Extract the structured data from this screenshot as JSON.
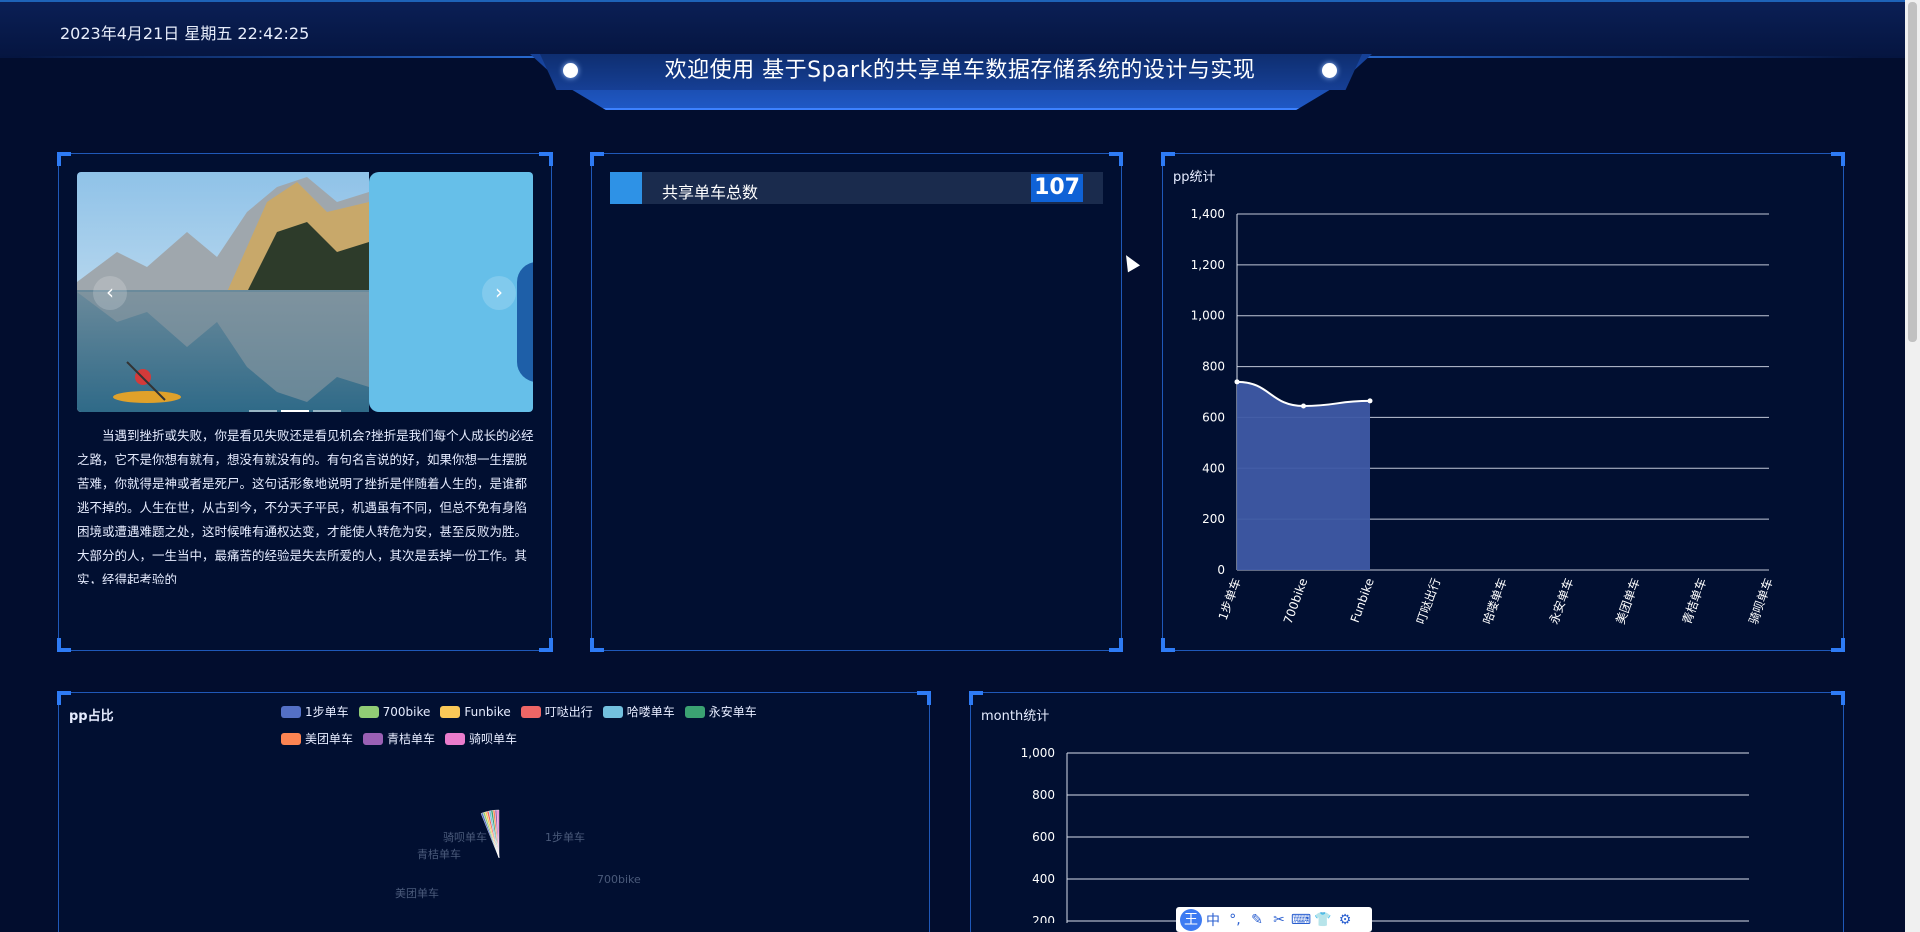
{
  "header": {
    "datetime": "2023年4月21日 星期五 22:42:25",
    "title": "欢迎使用 基于Spark的共享单车数据存储系统的设计与实现"
  },
  "carousel": {
    "prev_icon": "‹",
    "next_icon": "›",
    "paragraph": "当遇到挫折或失败，你是看见失败还是看见机会?挫折是我们每个人成长的必经之路，它不是你想有就有，想没有就没有的。有句名言说的好，如果你想一生摆脱苦难，你就得是神或者是死尸。这句话形象地说明了挫折是伴随着人生的，是谁都逃不掉的。人生在世，从古到今，不分天子平民，机遇虽有不同，但总不免有身陷困境或遭遇难题之处，这时候唯有通权达变，才能使人转危为安，甚至反败为胜。大部分的人，一生当中，最痛苦的经验是失去所爱的人，其次是丢掉一份工作。其实，经得起考验的"
  },
  "counter": {
    "label": "共享单车总数",
    "value": "107"
  },
  "pp_chart": {
    "title": "pp统计"
  },
  "pie_chart": {
    "title": "pp占比"
  },
  "month_chart": {
    "title": "month统计"
  },
  "colors": {
    "accent": "#2e7bf5",
    "area": "#3e5aa5",
    "background": "#020d2e"
  },
  "chart_data": [
    {
      "type": "area",
      "title": "pp统计",
      "categories": [
        "1步单车",
        "700bike",
        "Funbike",
        "叮哒出行",
        "哈喽单车",
        "永安单车",
        "美团单车",
        "青桔单车",
        "骑呗单车"
      ],
      "values": [
        740,
        645,
        665,
        null,
        null,
        null,
        null,
        null,
        null
      ],
      "ylim": [
        0,
        1400
      ],
      "yticks": [
        "0",
        "200",
        "400",
        "600",
        "800",
        "1,000",
        "1,200",
        "1,400"
      ],
      "grid": true
    },
    {
      "type": "pie",
      "title": "pp占比",
      "legend": [
        "1步单车",
        "700bike",
        "Funbike",
        "叮哒出行",
        "哈喽单车",
        "永安单车",
        "美团单车",
        "青桔单车",
        "骑呗单车"
      ],
      "colors": [
        "#5470c6",
        "#91cc75",
        "#fac858",
        "#ee6666",
        "#73c0de",
        "#3ba272",
        "#fc8452",
        "#9a60b4",
        "#ea7ccc"
      ],
      "slice_labels": [
        "1步单车",
        "700bike",
        "美团单车",
        "青桔单车",
        "骑呗单车"
      ],
      "legend_position": "top"
    },
    {
      "type": "bar",
      "title": "month统计",
      "ylim": [
        0,
        1000
      ],
      "yticks": [
        "200",
        "400",
        "600",
        "800",
        "1,000"
      ],
      "grid": true
    }
  ],
  "ime_toolbar": {
    "logo": "王",
    "lang": "中",
    "items": [
      "°,",
      "✎",
      "✂",
      "⌨",
      "👕",
      "⚙"
    ]
  }
}
